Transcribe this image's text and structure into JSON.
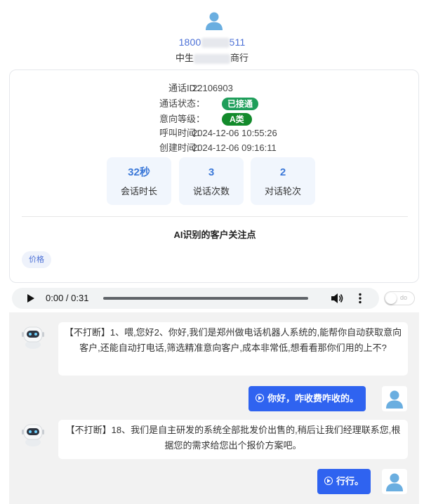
{
  "header": {
    "phone_prefix": "1800",
    "phone_suffix": "511",
    "company_prefix": "中生",
    "company_suffix": "商行"
  },
  "call": {
    "call_id_label": "通话ID：",
    "call_id": "22106903",
    "status_label": "通话状态：",
    "status": "已接通",
    "intent_label": "意向等级：",
    "intent": "A类",
    "call_time_label": "呼叫时间：",
    "call_time": "2024-12-06 10:55:26",
    "created_label": "创建时间：",
    "created_time": "2024-12-06 09:16:11"
  },
  "stats": [
    {
      "value": "32秒",
      "label": "会话时长"
    },
    {
      "value": "3",
      "label": "说话次数"
    },
    {
      "value": "2",
      "label": "对话轮次"
    }
  ],
  "focus": {
    "title": "AI识别的客户关注点",
    "tags": [
      "价格"
    ]
  },
  "player": {
    "time": "0:00 / 0:31",
    "progress": 0,
    "toggle_text": "do"
  },
  "messages": [
    {
      "role": "ai",
      "text": "【不打断】1、喂,您好2、你好,我们是郑州做电话机器人系统的,能帮你自动获取意向客户,还能自动打电话,筛选精准意向客户,成本非常低,想看看那你们用的上不?"
    },
    {
      "role": "user",
      "text": "你好，咋收费咋收的。"
    },
    {
      "role": "ai",
      "text": "【不打断】18、我们是自主研发的系统全部批发价出售的,稍后让我们经理联系您,根据您的需求给您出个报价方案吧。"
    },
    {
      "role": "user",
      "text": "行行。"
    }
  ],
  "colors": {
    "accent": "#2f63f0",
    "status_green": "#1e9e5a",
    "intent_green": "#128a2b",
    "stat_value": "#3b78d8",
    "phone": "#4a6fd6"
  }
}
